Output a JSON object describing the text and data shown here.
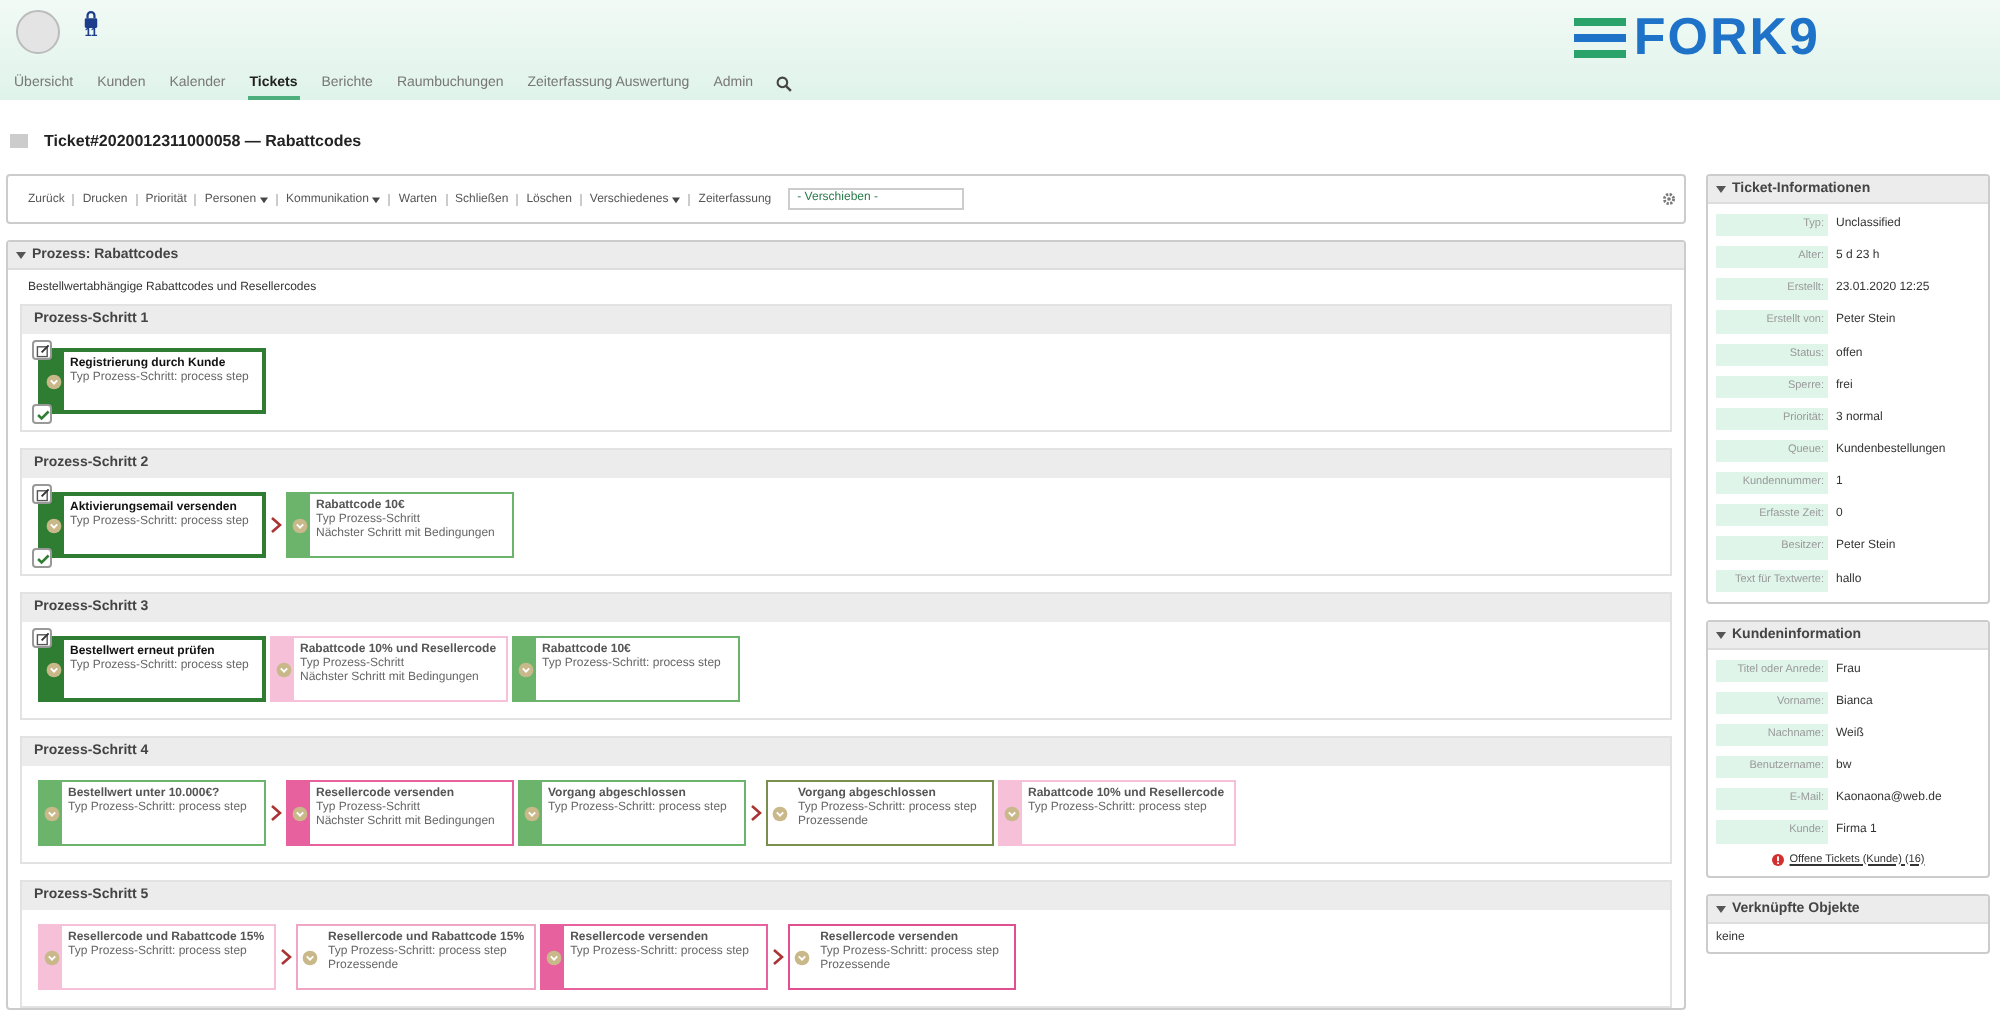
{
  "lock_badge": "11",
  "logo": "FORK9",
  "nav": [
    {
      "label": "Übersicht",
      "selected": false
    },
    {
      "label": "Kunden",
      "selected": false
    },
    {
      "label": "Kalender",
      "selected": false
    },
    {
      "label": "Tickets",
      "selected": true
    },
    {
      "label": "Berichte",
      "selected": false
    },
    {
      "label": "Raumbuchungen",
      "selected": false
    },
    {
      "label": "Zeiterfassung Auswertung",
      "selected": false
    },
    {
      "label": "Admin",
      "selected": false
    }
  ],
  "ticket_title": "Ticket#2020012311000058 — Rabattcodes",
  "toolbar": {
    "actions": [
      {
        "label": "Zurück",
        "dropdown": false
      },
      {
        "label": "Drucken",
        "dropdown": false
      },
      {
        "label": "Priorität",
        "dropdown": false
      },
      {
        "label": "Personen",
        "dropdown": true
      },
      {
        "label": "Kommunikation",
        "dropdown": true
      },
      {
        "label": "Warten",
        "dropdown": false
      },
      {
        "label": "Schließen",
        "dropdown": false
      },
      {
        "label": "Löschen",
        "dropdown": false
      },
      {
        "label": "Verschiedenes",
        "dropdown": true
      },
      {
        "label": "Zeiterfassung",
        "dropdown": false
      }
    ],
    "move_select": {
      "value": "- Verschieben -"
    }
  },
  "process": {
    "title": "Prozess: Rabattcodes",
    "expanded": true,
    "description": "Bestellwertabhängige Rabattcodes und Resellercodes",
    "steps": [
      {
        "title": "Prozess-Schritt 1",
        "cards": [
          {
            "title": "Registrierung durch Kunde",
            "lines": [
              "Typ Prozess-Schritt: process step"
            ],
            "kind": "stripe",
            "color": "#2f7d32",
            "current": true,
            "done": true,
            "arrow": false
          }
        ]
      },
      {
        "title": "Prozess-Schritt 2",
        "cards": [
          {
            "title": "Aktivierungsemail versenden",
            "lines": [
              "Typ Prozess-Schritt: process step"
            ],
            "kind": "stripe",
            "color": "#2f7d32",
            "current": true,
            "done": true,
            "arrow": false
          },
          {
            "title": "Rabattcode 10€",
            "lines": [
              "Typ Prozess-Schritt",
              "Nächster Schritt mit Bedingungen"
            ],
            "kind": "stripe",
            "color": "#6cb46c",
            "current": false,
            "done": false,
            "arrow": true
          }
        ]
      },
      {
        "title": "Prozess-Schritt 3",
        "cards": [
          {
            "title": "Bestellwert erneut prüfen",
            "lines": [
              "Typ Prozess-Schritt: process step"
            ],
            "kind": "stripe",
            "color": "#2f7d32",
            "current": true,
            "done": false,
            "arrow": false
          },
          {
            "title": "Rabattcode 10% und Resellercode",
            "lines": [
              "Typ Prozess-Schritt",
              "Nächster Schritt mit Bedingungen"
            ],
            "kind": "stripe",
            "color": "#f5c0d8",
            "current": false,
            "done": false,
            "arrow": false
          },
          {
            "title": "Rabattcode 10€",
            "lines": [
              "Typ Prozess-Schritt: process step"
            ],
            "kind": "stripe",
            "color": "#6cb46c",
            "current": false,
            "done": false,
            "arrow": false
          }
        ]
      },
      {
        "title": "Prozess-Schritt 4",
        "cards": [
          {
            "title": "Bestellwert unter 10.000€?",
            "lines": [
              "Typ Prozess-Schritt: process step"
            ],
            "kind": "stripe",
            "color": "#6cb46c",
            "current": false,
            "done": false,
            "arrow": false
          },
          {
            "title": "Resellercode versenden",
            "lines": [
              "Typ Prozess-Schritt",
              "Nächster Schritt mit Bedingungen"
            ],
            "kind": "stripe",
            "color": "#e8619f",
            "current": false,
            "done": false,
            "arrow": true
          },
          {
            "title": "Vorgang abgeschlossen",
            "lines": [
              "Typ Prozess-Schritt: process step"
            ],
            "kind": "stripe",
            "color": "#6cb46c",
            "current": false,
            "done": false,
            "arrow": false
          },
          {
            "title": "Vorgang abgeschlossen",
            "lines": [
              "Typ Prozess-Schritt: process step",
              "Prozessende"
            ],
            "kind": "outline",
            "color": "#7a8f4e",
            "current": false,
            "done": false,
            "arrow": true
          },
          {
            "title": "Rabattcode 10% und Resellercode",
            "lines": [
              "Typ Prozess-Schritt: process step"
            ],
            "kind": "stripe",
            "color": "#f5c0d8",
            "current": false,
            "done": false,
            "arrow": false
          }
        ]
      },
      {
        "title": "Prozess-Schritt 5",
        "cards": [
          {
            "title": "Resellercode und Rabattcode 15%",
            "lines": [
              "Typ Prozess-Schritt: process step"
            ],
            "kind": "stripe",
            "color": "#f5c0d8",
            "current": false,
            "done": false,
            "arrow": false
          },
          {
            "title": "Resellercode und Rabattcode 15%",
            "lines": [
              "Typ Prozess-Schritt: process step",
              "Prozessende"
            ],
            "kind": "outline",
            "color": "#f0a5c5",
            "current": false,
            "done": false,
            "arrow": true
          },
          {
            "title": "Resellercode versenden",
            "lines": [
              "Typ Prozess-Schritt: process step"
            ],
            "kind": "stripe",
            "color": "#e8619f",
            "current": false,
            "done": false,
            "arrow": false
          },
          {
            "title": "Resellercode versenden",
            "lines": [
              "Typ Prozess-Schritt: process step",
              "Prozessende"
            ],
            "kind": "outline",
            "color": "#e04f92",
            "current": false,
            "done": false,
            "arrow": true
          }
        ]
      }
    ]
  },
  "sidebar": {
    "ticket_info": {
      "title": "Ticket-Informationen",
      "expanded": true,
      "rows": [
        {
          "label": "Typ:",
          "value": "Unclassified"
        },
        {
          "label": "Alter:",
          "value": "5 d 23 h"
        },
        {
          "label": "Erstellt:",
          "value": "23.01.2020 12:25"
        },
        {
          "label": "Erstellt von:",
          "value": "Peter Stein"
        },
        {
          "label": "Status:",
          "value": "offen"
        },
        {
          "label": "Sperre:",
          "value": "frei"
        },
        {
          "label": "Priorität:",
          "value": "3 normal"
        },
        {
          "label": "Queue:",
          "value": "Kundenbestellungen"
        },
        {
          "label": "Kundennummer:",
          "value": "1"
        },
        {
          "label": "Erfasste Zeit:",
          "value": "0"
        },
        {
          "label": "Besitzer:",
          "value": "Peter Stein"
        },
        {
          "label": "Text für Textwerte:",
          "value": "hallo"
        }
      ]
    },
    "customer_info": {
      "title": "Kundeninformation",
      "expanded": true,
      "rows": [
        {
          "label": "Titel oder Anrede:",
          "value": "Frau"
        },
        {
          "label": "Vorname:",
          "value": "Bianca"
        },
        {
          "label": "Nachname:",
          "value": "Weiß"
        },
        {
          "label": "Benutzername:",
          "value": "bw"
        },
        {
          "label": "E-Mail:",
          "value": "Kaonaona@web.de"
        },
        {
          "label": "Kunde:",
          "value": "Firma 1"
        }
      ],
      "link": "Offene Tickets (Kunde) (16)"
    },
    "linked_objects": {
      "title": "Verknüpfte Objekte",
      "expanded": true,
      "text": "keine"
    }
  }
}
